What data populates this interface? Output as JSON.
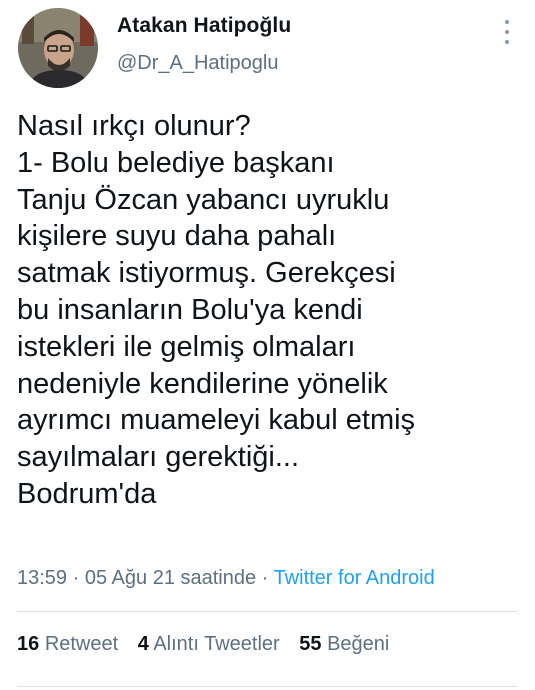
{
  "author": {
    "name": "Atakan Hatipoğlu",
    "handle": "@Dr_A_Hatipoglu",
    "avatar_icon": "user-photo"
  },
  "tweet": {
    "lines": [
      "Nasıl ırkçı olunur?",
      "1- Bolu belediye başkanı",
      "Tanju Özcan yabancı uyruklu",
      "kişilere suyu daha pahalı",
      "satmak istiyormuş. Gerekçesi",
      "bu insanların Bolu'ya kendi",
      "istekleri ile gelmiş olmaları",
      "nedeniyle kendilerine yönelik",
      "ayrımcı muameleyi kabul etmiş",
      "sayılmaları gerektiği...",
      "Bodrum'da"
    ],
    "time": "13:59",
    "separator": "·",
    "date": "05 Ağu 21 saatinde",
    "source": "Twitter for Android"
  },
  "stats": {
    "retweets": {
      "count": "16",
      "label": "Retweet"
    },
    "quotes": {
      "count": "4",
      "label": "Alıntı Tweetler"
    },
    "likes": {
      "count": "55",
      "label": "Beğeni"
    }
  },
  "colors": {
    "text": "#0f1419",
    "secondary": "#5b7083",
    "link": "#1da1f2",
    "divider": "#d9dfe3"
  }
}
